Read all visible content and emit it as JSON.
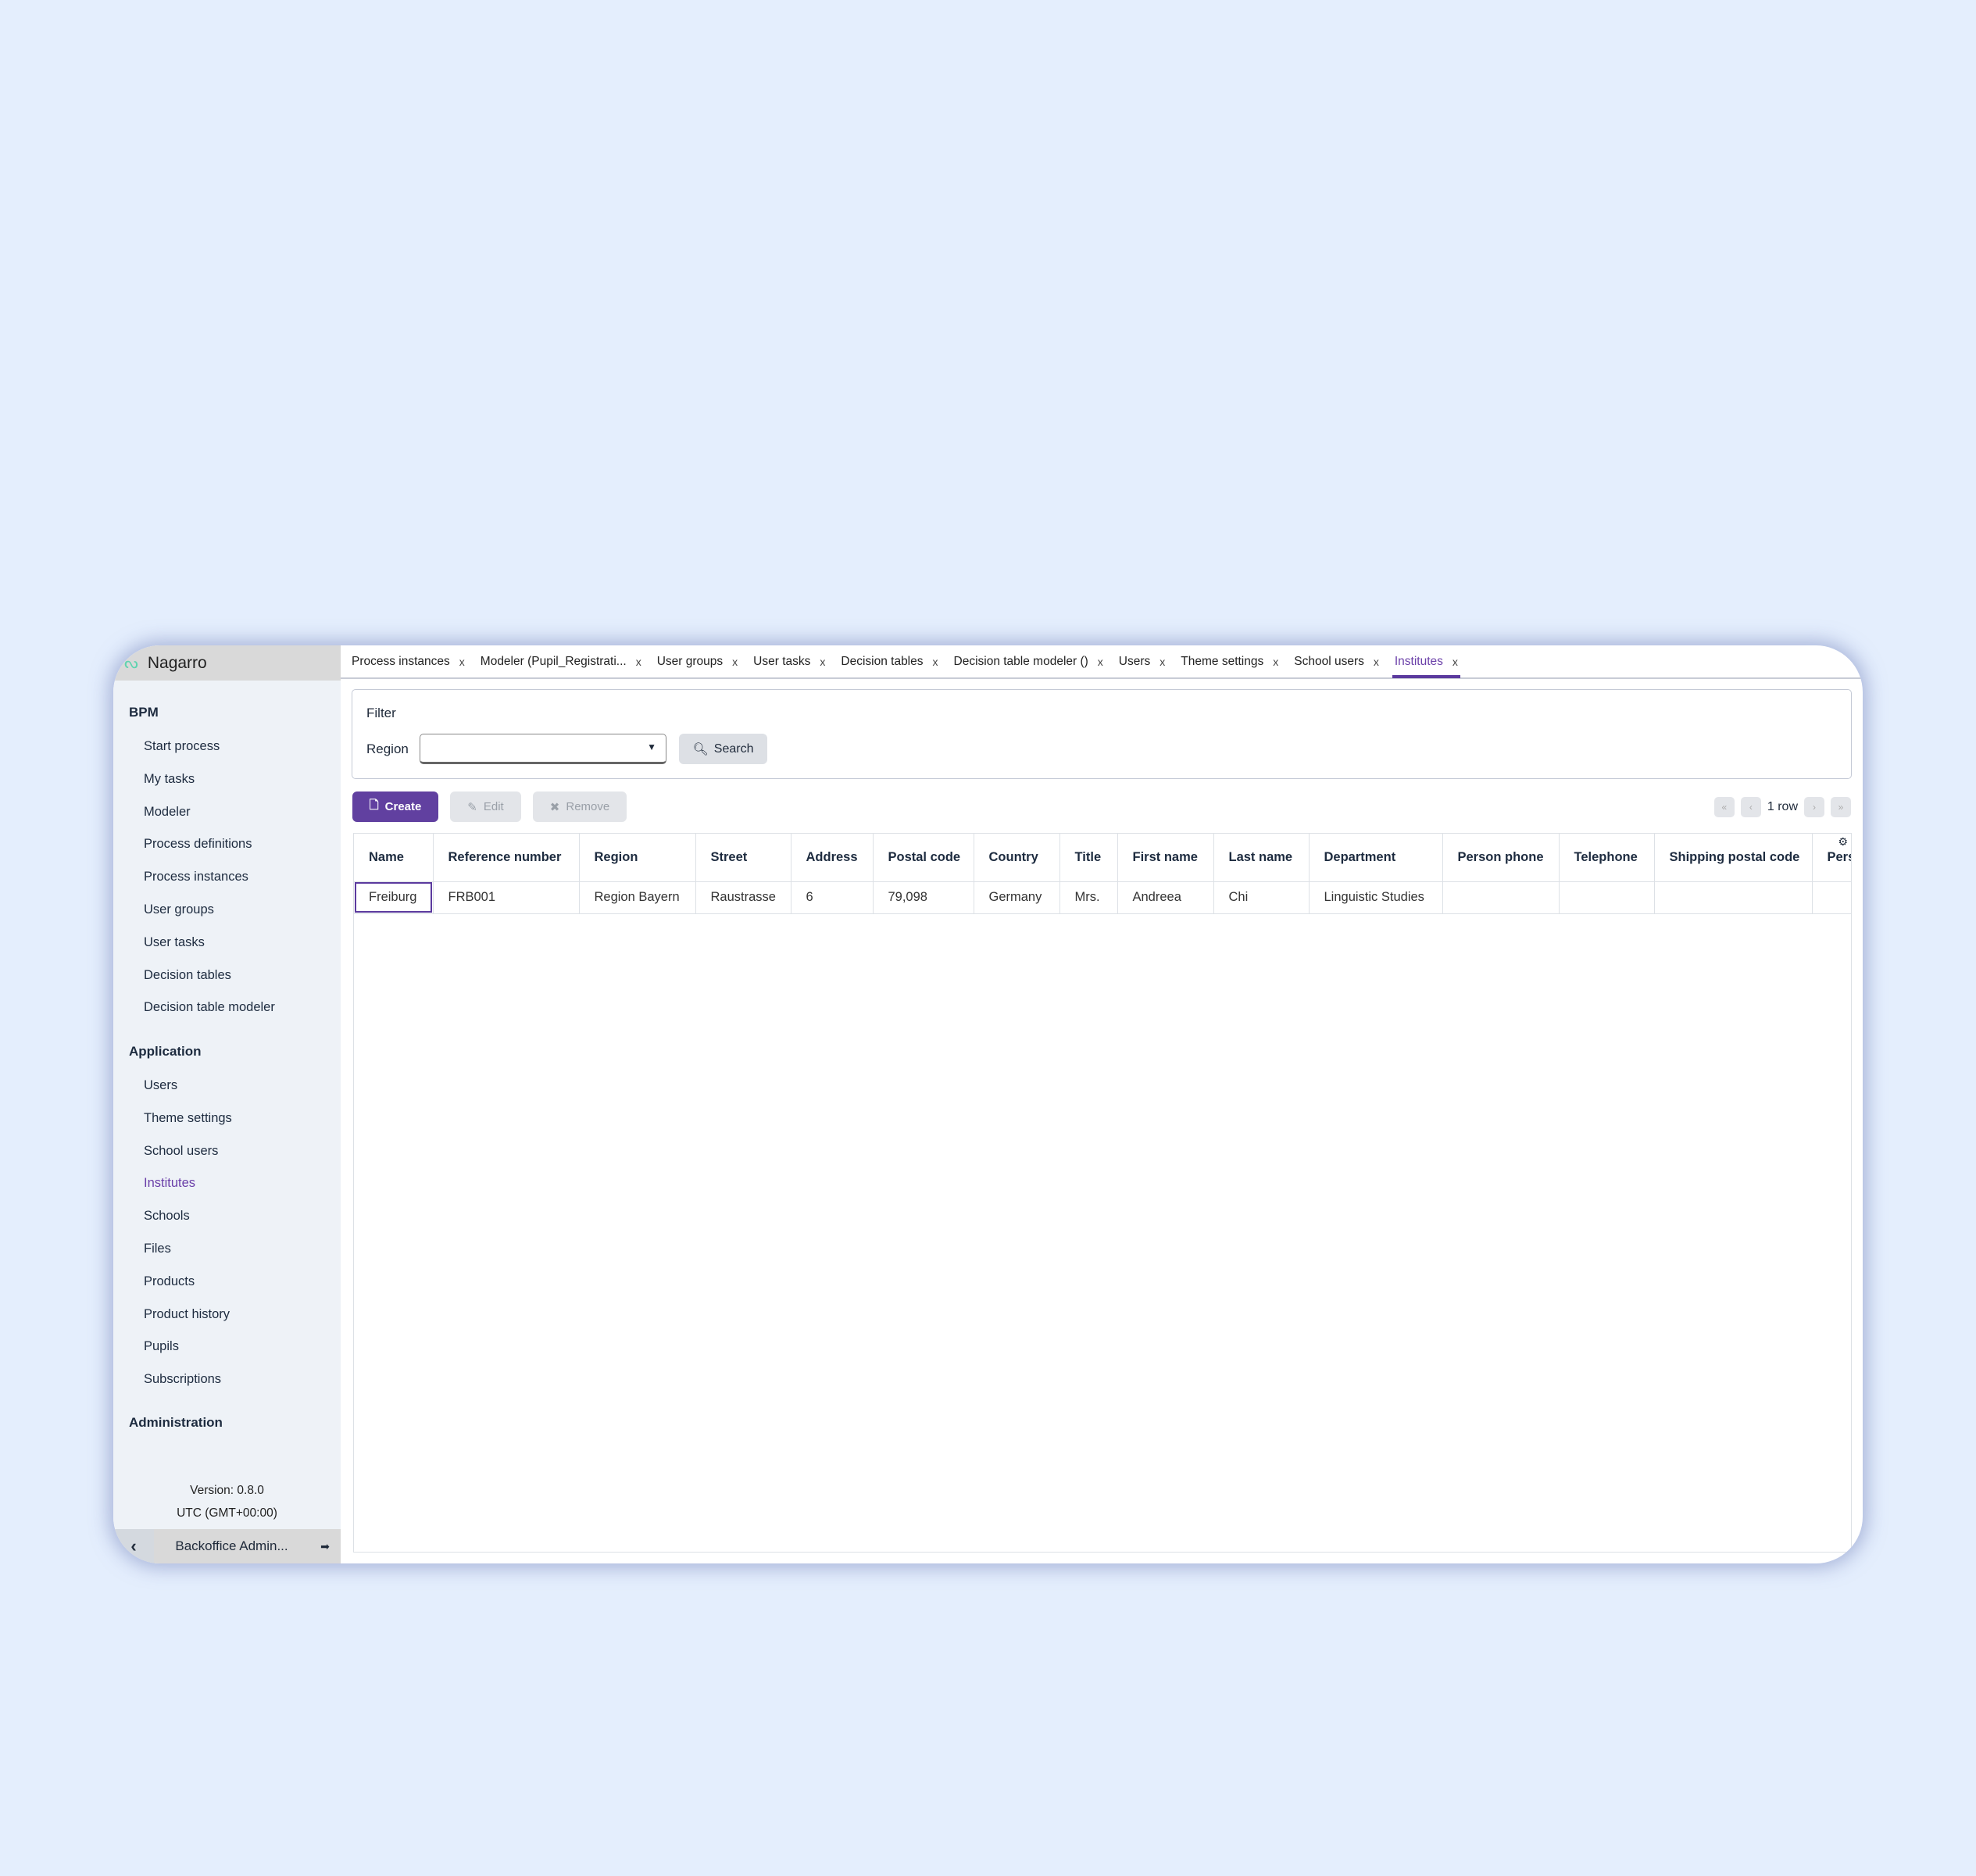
{
  "brand": {
    "name": "Nagarro",
    "logo_icon": "nagarro-logo"
  },
  "sidebar": {
    "sections": [
      {
        "title": "BPM",
        "items": [
          "Start process",
          "My tasks",
          "Modeler",
          "Process definitions",
          "Process instances",
          "User groups",
          "User tasks",
          "Decision tables",
          "Decision table modeler"
        ]
      },
      {
        "title": "Application",
        "items": [
          "Users",
          "Theme settings",
          "School users",
          "Institutes",
          "Schools",
          "Files",
          "Products",
          "Product history",
          "Pupils",
          "Subscriptions"
        ]
      },
      {
        "title": "Administration",
        "items": []
      }
    ],
    "active_item": "Institutes",
    "version": "Version: 0.8.0",
    "timezone": "UTC (GMT+00:00)",
    "user": "Backoffice Admin..."
  },
  "tabs": [
    "Process instances",
    "Modeler (Pupil_Registrati...",
    "User groups",
    "User tasks",
    "Decision tables",
    "Decision table modeler ()",
    "Users",
    "Theme settings",
    "School users",
    "Institutes"
  ],
  "active_tab": "Institutes",
  "tab_close": "x",
  "filter": {
    "title": "Filter",
    "region_label": "Region",
    "region_value": "",
    "search_label": "Search"
  },
  "toolbar": {
    "create": "Create",
    "edit": "Edit",
    "remove": "Remove"
  },
  "pagination": {
    "info": "1 row"
  },
  "table": {
    "columns": [
      "Name",
      "Reference number",
      "Region",
      "Street",
      "Address",
      "Postal code",
      "Country",
      "Title",
      "First name",
      "Last name",
      "Department",
      "Person phone",
      "Telephone",
      "Shipping postal code",
      "Pers"
    ],
    "rows": [
      [
        "Freiburg",
        "FRB001",
        "Region Bayern",
        "Raustrasse",
        "6",
        "79,098",
        "Germany",
        "Mrs.",
        "Andreea",
        "Chi",
        "Linguistic Studies",
        "",
        "",
        "",
        ""
      ]
    ]
  },
  "colors": {
    "accent": "#6140a0",
    "background": "#e4eefd"
  }
}
